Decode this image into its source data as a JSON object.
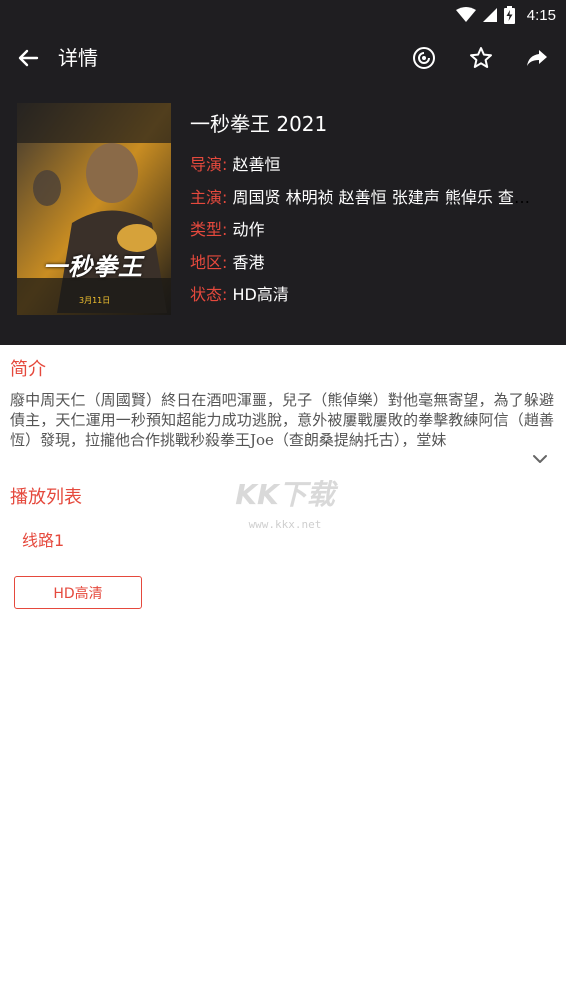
{
  "status_bar": {
    "time": "4:15"
  },
  "app_bar": {
    "title": "详情"
  },
  "movie": {
    "title": "一秒拳王 2021",
    "poster_title": "一秒拳王",
    "poster_date": "3月11日",
    "fields": [
      {
        "label": "导演:",
        "value": "赵善恒"
      },
      {
        "label": "主演:",
        "value": "周国贤 林明祯 赵善恒 张建声 熊倬乐 查朗桑提纳托古"
      },
      {
        "label": "类型:",
        "value": "动作"
      },
      {
        "label": "地区:",
        "value": "香港"
      },
      {
        "label": "状态:",
        "value": "HD高清"
      }
    ]
  },
  "intro": {
    "heading": "简介",
    "text": "廢中周天仁（周國賢）終日在酒吧渾噩，兒子（熊倬樂）對他毫無寄望，為了躲避債主，天仁運用一秒預知超能力成功逃脫，意外被屢戰屢敗的拳擊教練阿信（趙善恆）發現，拉攏他合作挑戰秒殺拳王Joe（查朗桑提納托古），堂妹"
  },
  "playlist": {
    "heading": "播放列表",
    "line": "线路1",
    "episode": "HD高清"
  },
  "watermark": {
    "brand": "KK下载",
    "url": "www.kkx.net"
  },
  "colors": {
    "accent": "#e5493d",
    "dark": "#1f1e21"
  }
}
